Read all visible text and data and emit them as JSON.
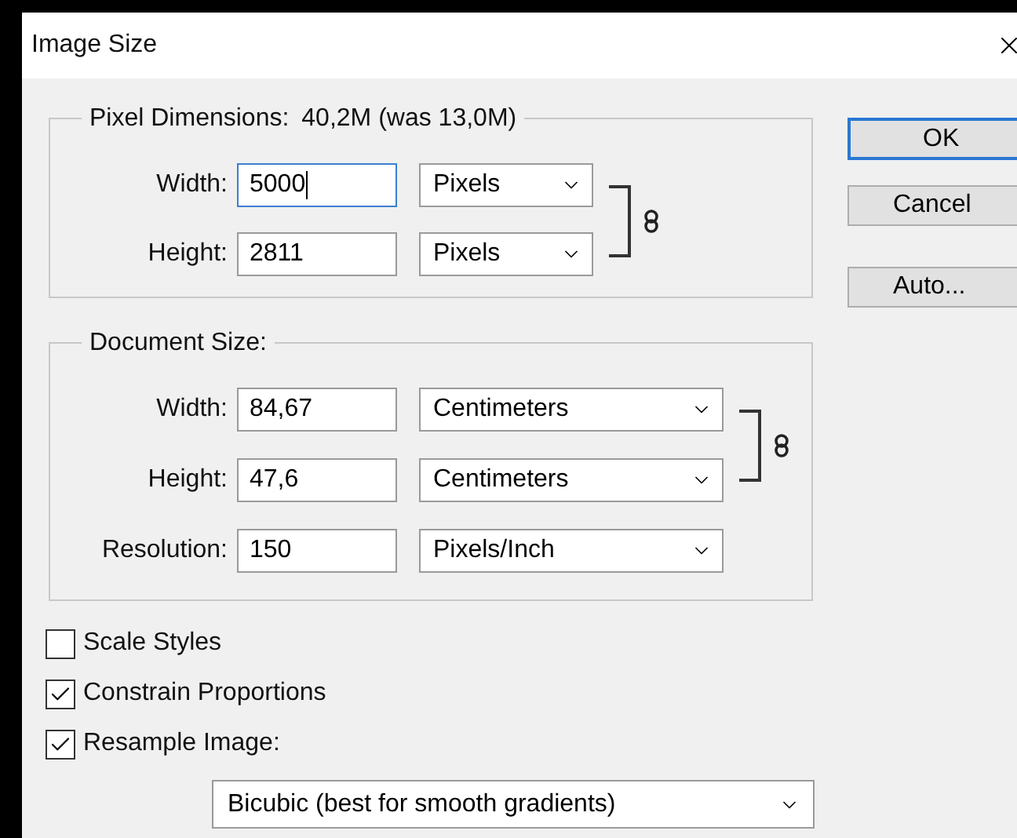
{
  "window": {
    "title": "Image Size"
  },
  "pixel_dimensions": {
    "legend": "Pixel Dimensions:",
    "info": "40,2M (was 13,0M)",
    "constrained": true,
    "fields": [
      {
        "label": "Width:",
        "value": "5000",
        "unit": "Pixels",
        "focused": true
      },
      {
        "label": "Height:",
        "value": "2811",
        "unit": "Pixels",
        "focused": false
      }
    ]
  },
  "document_size": {
    "legend": "Document Size:",
    "constrained": true,
    "fields": [
      {
        "label": "Width:",
        "value": "84,67",
        "unit": "Centimeters",
        "focused": false
      },
      {
        "label": "Height:",
        "value": "47,6",
        "unit": "Centimeters",
        "focused": false
      },
      {
        "label": "Resolution:",
        "value": "150",
        "unit": "Pixels/Inch",
        "focused": false
      }
    ]
  },
  "checkboxes": [
    {
      "label": "Scale Styles",
      "checked": false
    },
    {
      "label": "Constrain Proportions",
      "checked": true
    },
    {
      "label": "Resample Image:",
      "checked": true
    }
  ],
  "resample_method": "Bicubic (best for smooth gradients)",
  "buttons": [
    {
      "label": "OK",
      "default": true
    },
    {
      "label": "Cancel",
      "default": false
    },
    {
      "label": "Auto...",
      "default": false
    }
  ]
}
